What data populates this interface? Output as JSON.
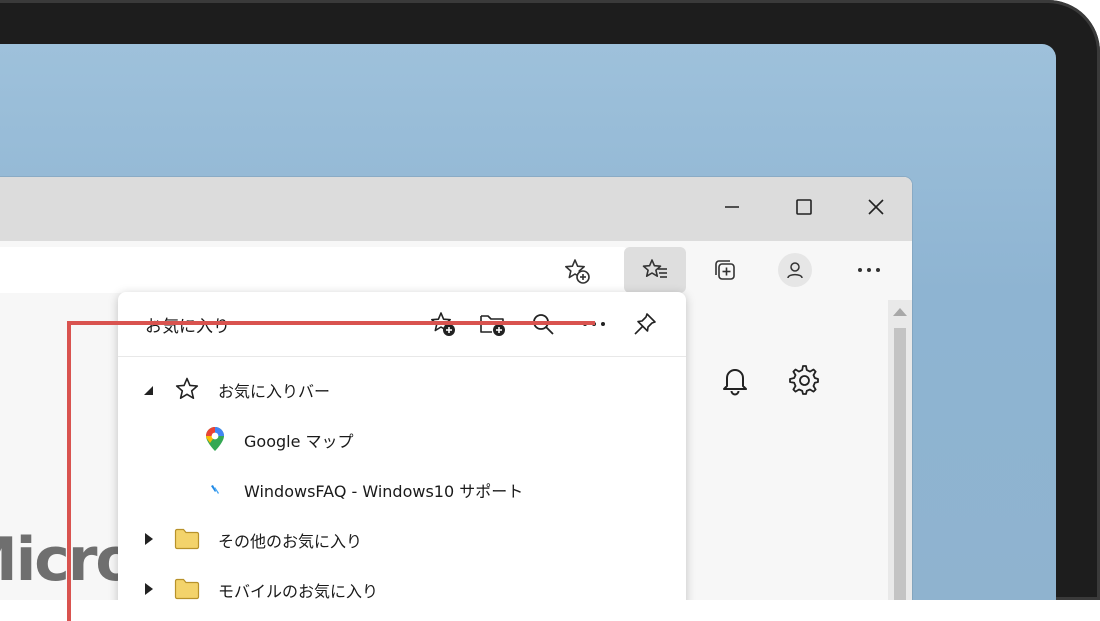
{
  "window_controls": {
    "minimize_icon": "minimize-icon",
    "maximize_icon": "maximize-icon",
    "close_icon": "close-icon"
  },
  "toolbar": {
    "add_favorite_icon": "star-plus-icon",
    "favorites_icon": "favorites-icon",
    "collections_icon": "collections-icon",
    "profile_icon": "person-icon",
    "more_icon": "more-horizontal-icon"
  },
  "page": {
    "partial_logo_text": "Micros",
    "notification_icon": "bell-icon",
    "settings_icon": "gear-icon"
  },
  "favorites_panel": {
    "title": "お気に入り",
    "header_actions": [
      {
        "icon": "star-plus-icon"
      },
      {
        "icon": "folder-plus-icon"
      },
      {
        "icon": "search-icon"
      },
      {
        "icon": "more-horizontal-icon"
      },
      {
        "icon": "pin-icon"
      }
    ],
    "items": [
      {
        "label": "お気に入りバー",
        "type": "folder-expanded",
        "icon": "star-icon"
      },
      {
        "label": "Google マップ",
        "type": "link",
        "icon": "google-maps-icon"
      },
      {
        "label": "WindowsFAQ - Windows10  サポート",
        "type": "link",
        "icon": "windowsfaq-icon"
      },
      {
        "label": "その他のお気に入り",
        "type": "folder-collapsed",
        "icon": "folder-icon"
      },
      {
        "label": "モバイルのお気に入り",
        "type": "folder-collapsed",
        "icon": "folder-icon"
      }
    ]
  },
  "colors": {
    "accent_line": "#d9534f",
    "folder": "#f3d36b",
    "bezel": "#1d1d1d"
  }
}
